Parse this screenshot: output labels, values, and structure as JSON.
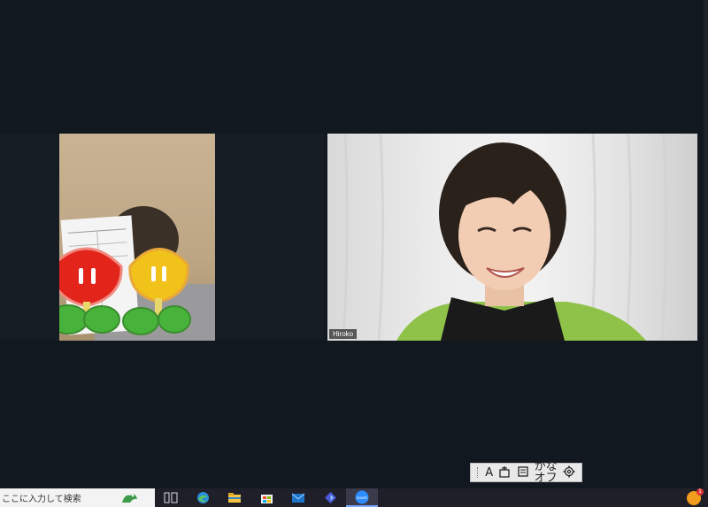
{
  "participants": {
    "left": {
      "name": ""
    },
    "right": {
      "name": "Hiroko"
    }
  },
  "ime_toolbar": {
    "mode_label": "A",
    "kana_line1": "かな",
    "kana_line2": "オフ"
  },
  "taskbar": {
    "search_placeholder": "ここに入力して検索",
    "notification_count": "1",
    "icons": [
      "task-view-icon",
      "edge-icon",
      "file-explorer-icon",
      "store-icon",
      "mail-icon",
      "app-icon",
      "zoom-icon"
    ],
    "zoom_label": "zoom"
  },
  "colors": {
    "background": "#121820",
    "taskbar": "#1f1f2a",
    "accent": "#7aa7ff"
  }
}
